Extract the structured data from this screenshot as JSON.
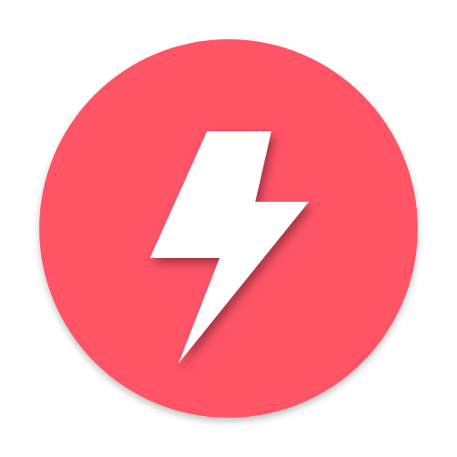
{
  "icon": {
    "name": "lightning-bolt-icon",
    "shape": "circle",
    "colors": {
      "background_circle": "#FF5366",
      "bolt": "#FFFFFF",
      "page_background": "#FFFFFF"
    }
  }
}
